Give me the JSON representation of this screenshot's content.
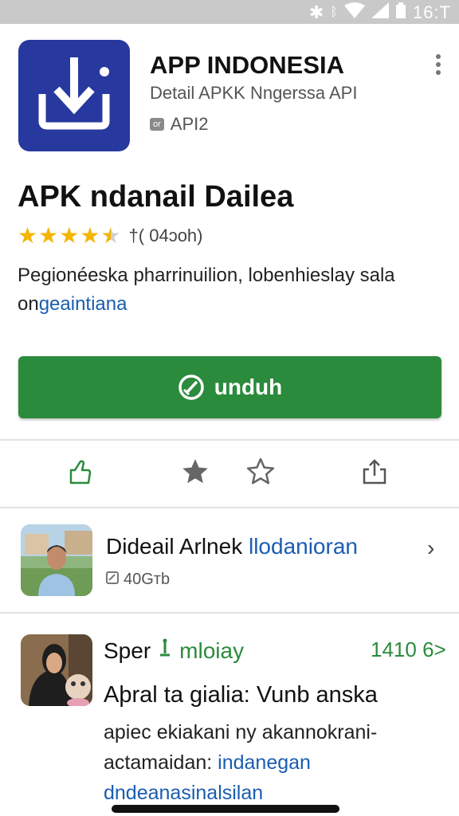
{
  "status_bar": {
    "time": "16:T",
    "icons": [
      "bluetooth-icon",
      "bluetooth-icon",
      "wifi-icon",
      "signal-icon",
      "battery-icon"
    ]
  },
  "app": {
    "name": "APP INDONESIA",
    "subtitle": "Detail APKK Nngerssa API",
    "tag_badge": "or",
    "tag_label": "API2",
    "icon_name": "download-tray-icon",
    "icon_color": "#27399e"
  },
  "page": {
    "title": "APK ndanail Dailea",
    "rating_value": 4.5,
    "rating_count": "†( 04ɔoh)",
    "description": "Pegionéeska pharrinuilion, lobenhieslay sala on",
    "description_link": "geaintiana"
  },
  "download_button": {
    "label": "unduh",
    "color": "#2b8b3c"
  },
  "actions": [
    {
      "name": "like-icon"
    },
    {
      "name": "star-filled-icon"
    },
    {
      "name": "star-outline-icon"
    },
    {
      "name": "share-icon"
    }
  ],
  "related": {
    "title": "Dideail Arlnek",
    "title_link": "llodanioran",
    "meta": "40Gтb"
  },
  "review": {
    "author": "Sper",
    "author_tag": "mloiay",
    "count": "1410 6>",
    "headline": "Aþral ta gialia: Vunb anska",
    "body_prefix": "apiec",
    "body_text": "ekiakani ny akannokrani-",
    "body_line2": "actamaidan:",
    "body_link": "indanegan",
    "body_link2": "dndeanasinalsilan"
  },
  "colors": {
    "accent_green": "#2b8b3c",
    "link_blue": "#1a5db0",
    "star_gold": "#f4b400"
  }
}
